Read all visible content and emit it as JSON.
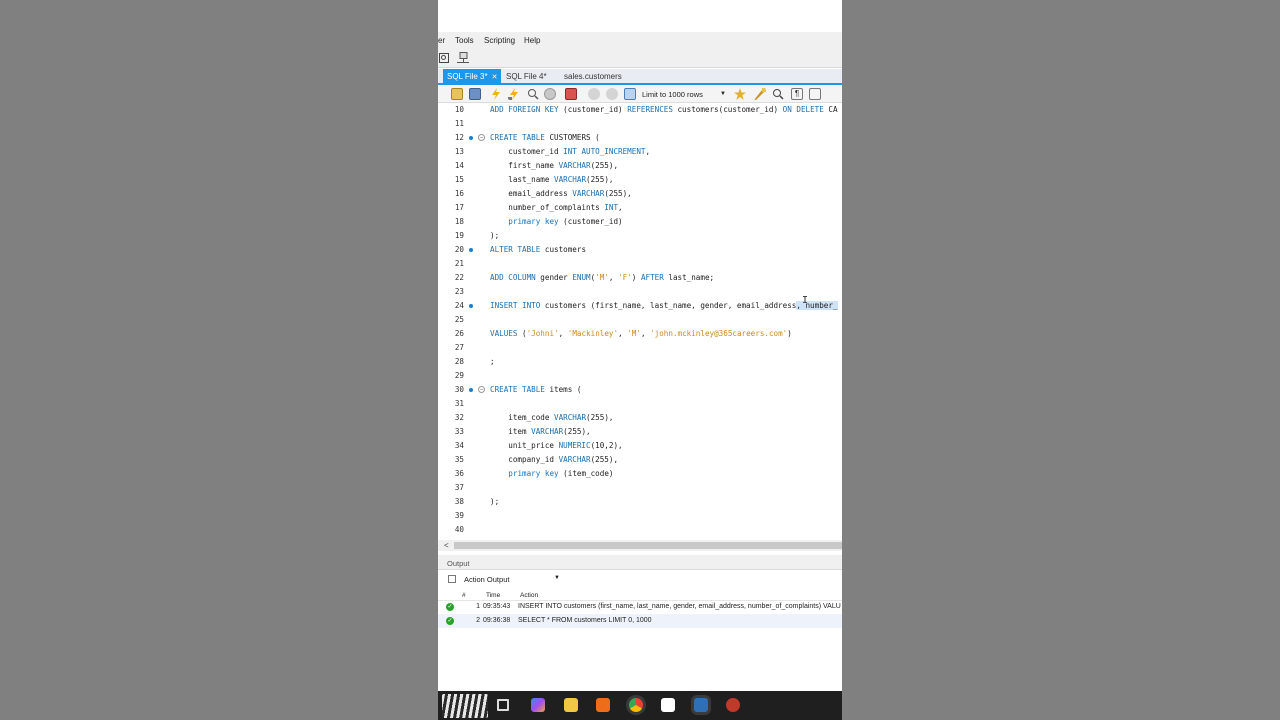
{
  "menu": {
    "partial": "er",
    "tools": "Tools",
    "scripting": "Scripting",
    "help": "Help"
  },
  "tabs": [
    {
      "label": "SQL File 3*",
      "active": true
    },
    {
      "label": "SQL File 4*",
      "active": false
    },
    {
      "label": "sales.customers",
      "active": false
    }
  ],
  "toolbar": {
    "limit_label": "Limit to 1000 rows",
    "icons": [
      "open-folder-icon",
      "save-icon",
      "execute-icon",
      "execute-current-icon",
      "explain-icon",
      "stop-icon",
      "toggle-errors-icon",
      "commit-icon",
      "rollback-icon",
      "autocommit-icon",
      "limit-dropdown",
      "bookmark-icon",
      "beautify-icon",
      "find-icon",
      "invisible-chars-icon",
      "wrap-icon"
    ]
  },
  "editor": {
    "lines": [
      {
        "num": "10",
        "text": "ADD FOREIGN KEY (customer_id) REFERENCES customers(customer_id) ON DELETE CA"
      },
      {
        "num": "11",
        "text": ""
      },
      {
        "num": "12",
        "text": "CREATE TABLE CUSTOMERS (",
        "marker": true,
        "fold": true
      },
      {
        "num": "13",
        "text": "    customer_id INT AUTO_INCREMENT,"
      },
      {
        "num": "14",
        "text": "    first_name VARCHAR(255),"
      },
      {
        "num": "15",
        "text": "    last_name VARCHAR(255),"
      },
      {
        "num": "16",
        "text": "    email_address VARCHAR(255),"
      },
      {
        "num": "17",
        "text": "    number_of_complaints INT,"
      },
      {
        "num": "18",
        "text": "    primary key (customer_id)"
      },
      {
        "num": "19",
        "text": ");"
      },
      {
        "num": "20",
        "text": "ALTER TABLE customers",
        "marker": true
      },
      {
        "num": "21",
        "text": ""
      },
      {
        "num": "22",
        "text": "ADD COLUMN gender ENUM('M', 'F') AFTER last_name;"
      },
      {
        "num": "23",
        "text": ""
      },
      {
        "num": "24",
        "text": "INSERT INTO customers (first_name, last_name, gender, email_address, number_",
        "marker": true
      },
      {
        "num": "25",
        "text": ""
      },
      {
        "num": "26",
        "text": "VALUES ('Johni', 'Mackinley', 'M', 'john.mckinley@365careers.com')"
      },
      {
        "num": "27",
        "text": ""
      },
      {
        "num": "28",
        "text": ";"
      },
      {
        "num": "29",
        "text": ""
      },
      {
        "num": "30",
        "text": "CREATE TABLE items (",
        "marker": true,
        "fold": true
      },
      {
        "num": "31",
        "text": ""
      },
      {
        "num": "32",
        "text": "    item_code VARCHAR(255),"
      },
      {
        "num": "33",
        "text": "    item VARCHAR(255),"
      },
      {
        "num": "34",
        "text": "    unit_price NUMERIC(10,2),"
      },
      {
        "num": "35",
        "text": "    company_id VARCHAR(255),"
      },
      {
        "num": "36",
        "text": "    primary key (item_code)"
      },
      {
        "num": "37",
        "text": ""
      },
      {
        "num": "38",
        "text": ");"
      },
      {
        "num": "39",
        "text": ""
      },
      {
        "num": "40",
        "text": ""
      }
    ]
  },
  "output": {
    "title": "Output",
    "selector": "Action Output",
    "columns": {
      "num": "#",
      "time": "Time",
      "action": "Action"
    },
    "rows": [
      {
        "num": "1",
        "time": "09:35:43",
        "action": "INSERT INTO customers (first_name, last_name, gender, email_address, number_of_complaints)  VALU"
      },
      {
        "num": "2",
        "time": "09:36:38",
        "action": "SELECT * FROM customers LIMIT 0, 1000"
      }
    ]
  },
  "taskbar": {
    "apps": [
      "zebra-wallpaper-thumb",
      "task-view-icon",
      "copilot-icon",
      "file-explorer-icon",
      "sublime-icon",
      "chrome-icon",
      "capcut-icon",
      "mysql-workbench-icon",
      "davinci-icon"
    ]
  },
  "colors": {
    "accent": "#1c97ea",
    "keyword": "#1a6fb3",
    "string": "#c98a1a",
    "selection": "#cfe3f7",
    "success": "#2aa12a"
  }
}
